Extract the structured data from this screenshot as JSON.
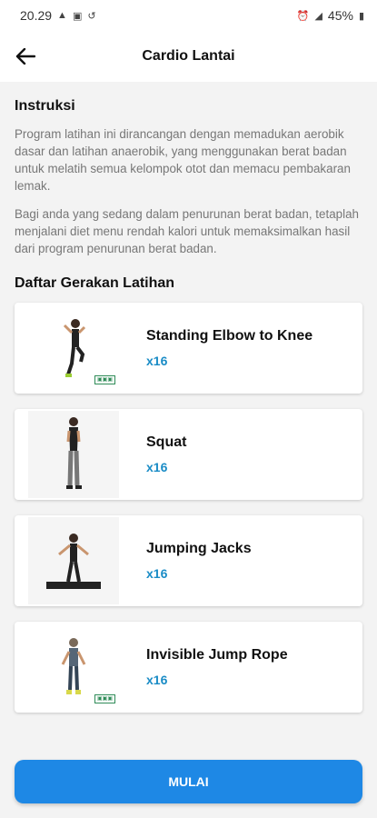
{
  "status": {
    "time": "20.29",
    "battery": "45%"
  },
  "appbar": {
    "title": "Cardio Lantai"
  },
  "instructions": {
    "heading": "Instruksi",
    "para1": "Program latihan ini dirancangan dengan memadukan aerobik dasar dan latihan anaerobik, yang menggunakan berat badan untuk melatih semua kelompok otot dan memacu pembakaran lemak.",
    "para2": "Bagi anda yang sedang dalam penurunan berat badan, tetaplah menjalani diet menu rendah kalori untuk memaksimalkan hasil dari program penurunan berat badan."
  },
  "exercises": {
    "heading": "Daftar Gerakan Latihan",
    "items": [
      {
        "name": "Standing Elbow to Knee",
        "reps": "x16"
      },
      {
        "name": "Squat",
        "reps": "x16"
      },
      {
        "name": "Jumping Jacks",
        "reps": "x16"
      },
      {
        "name": "Invisible Jump Rope",
        "reps": "x16"
      }
    ]
  },
  "action": {
    "start_label": "MULAI"
  },
  "colors": {
    "accent": "#1e88e5",
    "reps": "#1a8cc6"
  }
}
